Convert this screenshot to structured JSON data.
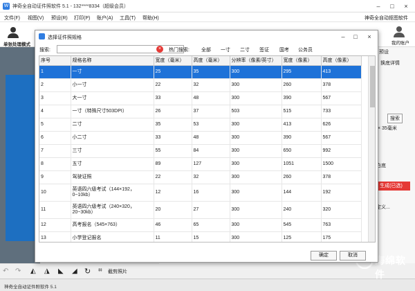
{
  "app": {
    "title": "神奇全自动证件照软件 5.1 - 132****8334（超级会员）",
    "brand": "神奇全自动抠图软件",
    "menu": [
      "文件(F)",
      "视图(V)",
      "预设(R)",
      "打印(P)",
      "账户(A)",
      "工具(T)",
      "帮助(H)"
    ],
    "mode_label": "单张处理模式",
    "my_account": "我的账户",
    "status": "神奇全自动证件照软件 5.1",
    "crop_photo": "截剪照片",
    "right_panel": {
      "preset": "预设",
      "tab": "换底详情",
      "size": "× 35毫米",
      "search": "搜索",
      "white_bg": "白底",
      "generate": "生成(已选)",
      "define": "定义..."
    }
  },
  "dialog": {
    "title": "选择证件照规格",
    "search_label": "搜索:",
    "search_value": "",
    "hot_label": "热门搜索:",
    "hot": [
      "全部",
      "一寸",
      "二寸",
      "签证",
      "国考",
      "公务员"
    ],
    "columns": [
      "序号",
      "规格名称",
      "宽度（毫米）",
      "高度（毫米）",
      "分辨率（像素/英寸）",
      "宽度（像素）",
      "高度（像素）"
    ],
    "rows": [
      [
        "1",
        "一寸",
        "25",
        "35",
        "300",
        "295",
        "413"
      ],
      [
        "2",
        "小一寸",
        "22",
        "32",
        "300",
        "260",
        "378"
      ],
      [
        "3",
        "大一寸",
        "33",
        "48",
        "300",
        "390",
        "567"
      ],
      [
        "4",
        "一寸（特殊尺寸503DPI）",
        "26",
        "37",
        "503",
        "515",
        "733"
      ],
      [
        "5",
        "二寸",
        "35",
        "53",
        "300",
        "413",
        "626"
      ],
      [
        "6",
        "小二寸",
        "33",
        "48",
        "300",
        "390",
        "567"
      ],
      [
        "7",
        "三寸",
        "55",
        "84",
        "300",
        "650",
        "992"
      ],
      [
        "8",
        "五寸",
        "89",
        "127",
        "300",
        "1051",
        "1500"
      ],
      [
        "9",
        "驾驶证照",
        "22",
        "32",
        "300",
        "260",
        "378"
      ],
      [
        "10",
        "英语四六级考试（144×192，0~10kb）",
        "12",
        "16",
        "300",
        "144",
        "192"
      ],
      [
        "11",
        "英语四六级考试（240×320，20~30kb）",
        "20",
        "27",
        "300",
        "240",
        "320"
      ],
      [
        "12",
        "高考报名（545×763）",
        "46",
        "65",
        "300",
        "545",
        "763"
      ],
      [
        "13",
        "小学登记报名",
        "11",
        "15",
        "300",
        "125",
        "175"
      ]
    ],
    "ok": "确定",
    "cancel": "取消"
  },
  "watermark": "海绵软件"
}
